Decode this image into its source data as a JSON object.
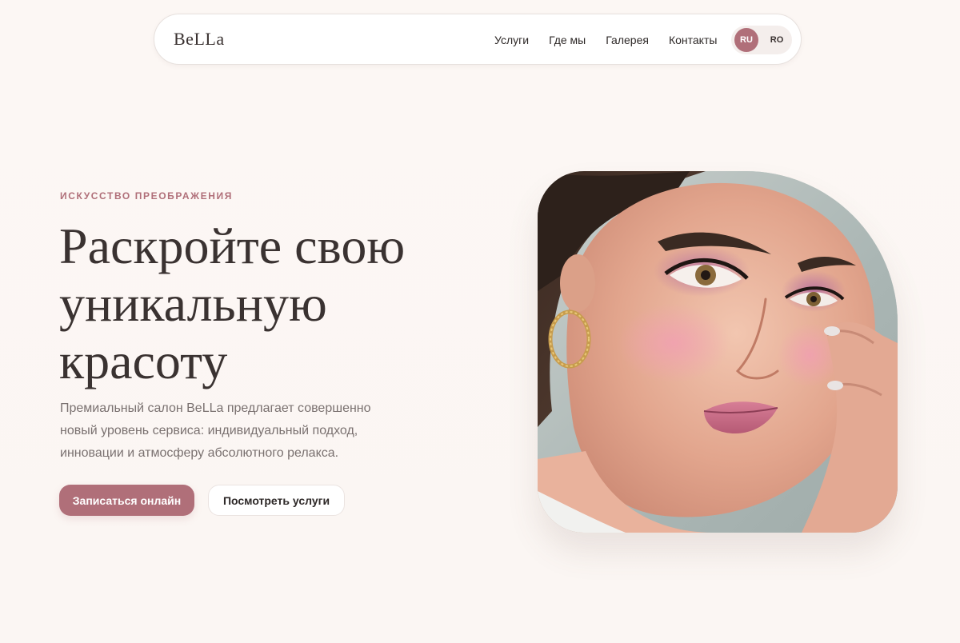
{
  "brand": {
    "logo": "BeLLa"
  },
  "nav": {
    "links": [
      {
        "label": "Услуги"
      },
      {
        "label": "Где мы"
      },
      {
        "label": "Галерея"
      },
      {
        "label": "Контакты"
      }
    ],
    "languages": [
      {
        "code": "RU",
        "active": true
      },
      {
        "code": "RO",
        "active": false
      }
    ]
  },
  "hero": {
    "eyebrow": "ИСКУССТВО ПРЕОБРАЖЕНИЯ",
    "title_lines": [
      "Раскройте свою",
      "уникальную",
      "красоту"
    ],
    "description": "Премиальный салон BeLLa предлагает совершенно новый уровень сервиса: индивидуальный подход, инновации и атмосферу абсолютного релакса.",
    "primary_button": "Записаться онлайн",
    "secondary_button": "Посмотреть услуги",
    "image_subject": "woman-portrait-makeup"
  },
  "colors": {
    "accent": "#b06f79",
    "background": "#fcf7f4",
    "text": "#3a3231",
    "muted_text": "#7a7170"
  }
}
